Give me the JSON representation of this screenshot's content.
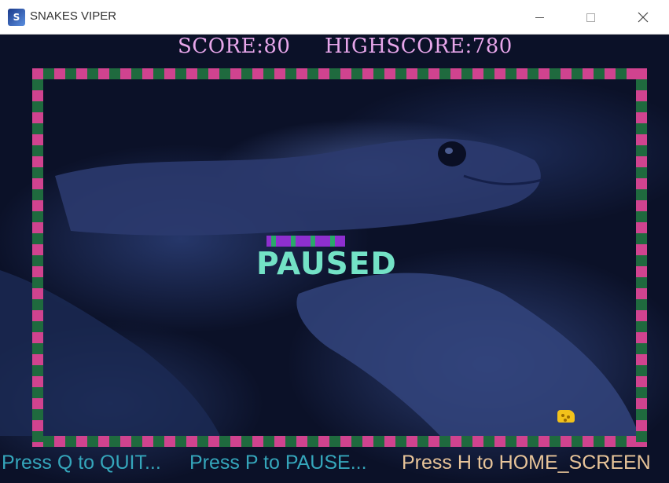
{
  "window": {
    "title": "SNAKES VIPER",
    "icon": "snake-app-icon",
    "controls": [
      "minimize",
      "maximize",
      "close"
    ]
  },
  "hud": {
    "score_text": "SCORE:80",
    "highscore_text": "HIGHSCORE:780"
  },
  "game": {
    "status_text": "PAUSED",
    "score": 80,
    "highscore": 780,
    "border_colors": [
      "#d0438f",
      "#1f6a3e"
    ],
    "snake_colors": [
      "#8e2fcf",
      "#29a86a"
    ],
    "food_color": "#f2c21a",
    "food_icon": "cheese-icon"
  },
  "footer": {
    "quit_hint": "Press Q to QUIT...",
    "pause_hint": "Press P to PAUSE...",
    "home_hint": "Press H to HOME_SCREEN"
  },
  "colors": {
    "score_text": "#e7a6ea",
    "paused_text": "#73e2c6",
    "hint_primary": "#35a6bb",
    "hint_home": "#e8c499",
    "background": "#0b1128"
  }
}
